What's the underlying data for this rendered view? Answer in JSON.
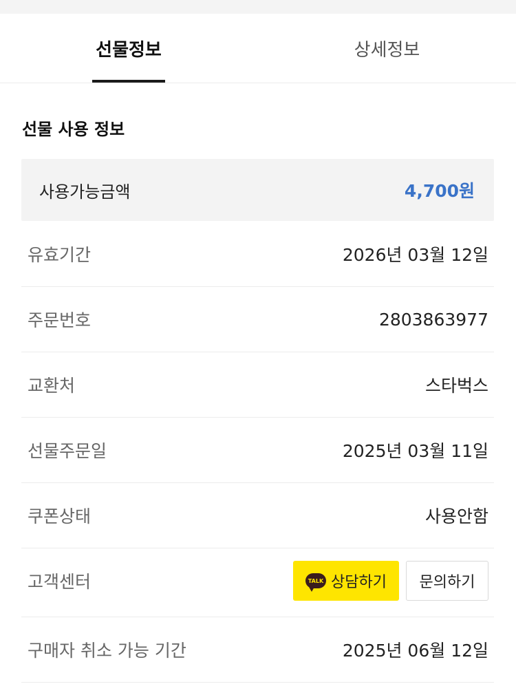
{
  "tabs": {
    "gift_info": "선물정보",
    "detail_info": "상세정보"
  },
  "section": {
    "title": "선물 사용 정보"
  },
  "amount": {
    "label": "사용가능금액",
    "value": "4,700원"
  },
  "rows": [
    {
      "label": "유효기간",
      "value": "2026년 03월 12일"
    },
    {
      "label": "주문번호",
      "value": "2803863977"
    },
    {
      "label": "교환처",
      "value": "스타벅스"
    },
    {
      "label": "선물주문일",
      "value": "2025년 03월 11일"
    },
    {
      "label": "쿠폰상태",
      "value": "사용안함"
    },
    {
      "label": "고객센터",
      "value": ""
    },
    {
      "label": "구매자 취소 가능 기간",
      "value": "2025년 06월 12일"
    }
  ],
  "support": {
    "talk_icon_text": "TALK",
    "kakao_button": "상담하기",
    "inquiry_button": "문의하기"
  },
  "colors": {
    "amount_value": "#3a73c8",
    "kakao_yellow": "#fee500"
  },
  "icons": [
    "kakao-talk-icon"
  ]
}
